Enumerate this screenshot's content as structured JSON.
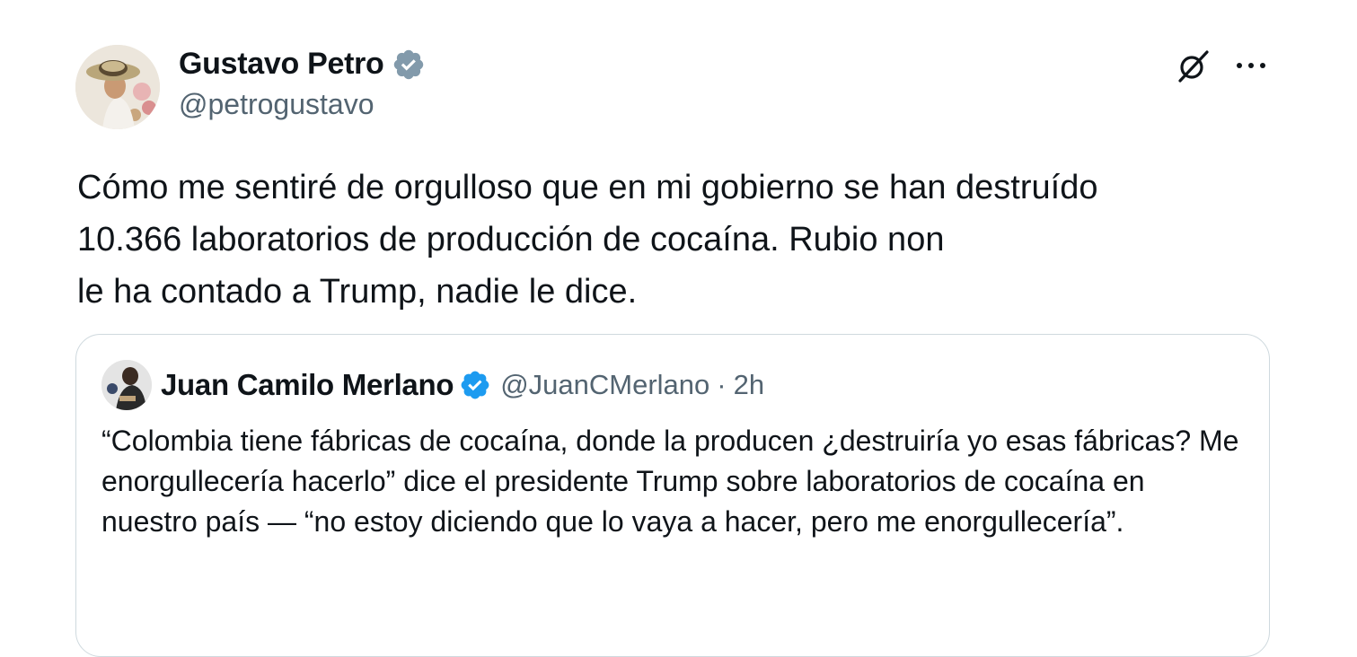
{
  "tweet": {
    "author": {
      "name": "Gustavo Petro",
      "handle": "@petrogustavo",
      "verified_color": "#829aab"
    },
    "text": "Cómo me sentiré de orgulloso que en mi gobierno se han destruído\n10.366 laboratorios de producción de cocaína. Rubio non\n le ha contado a Trump, nadie le dice.",
    "actions": {
      "grok_icon": "grok-icon",
      "more_icon": "more-options-icon"
    }
  },
  "quoted_tweet": {
    "author": {
      "name": "Juan Camilo Merlano",
      "handle": "@JuanCMerlano",
      "verified_color": "#1d9bf0"
    },
    "separator": "·",
    "time": "2h",
    "text": "“Colombia tiene fábricas de cocaína, donde la producen ¿destruiría yo esas fábricas? Me enorgullecería hacerlo” dice el presidente Trump sobre laboratorios de cocaína en nuestro país — “no estoy diciendo que lo vaya a hacer, pero me enorgullecería”."
  },
  "colors": {
    "text_primary": "#0f1419",
    "text_secondary": "#536471",
    "border": "#cfd9de"
  }
}
